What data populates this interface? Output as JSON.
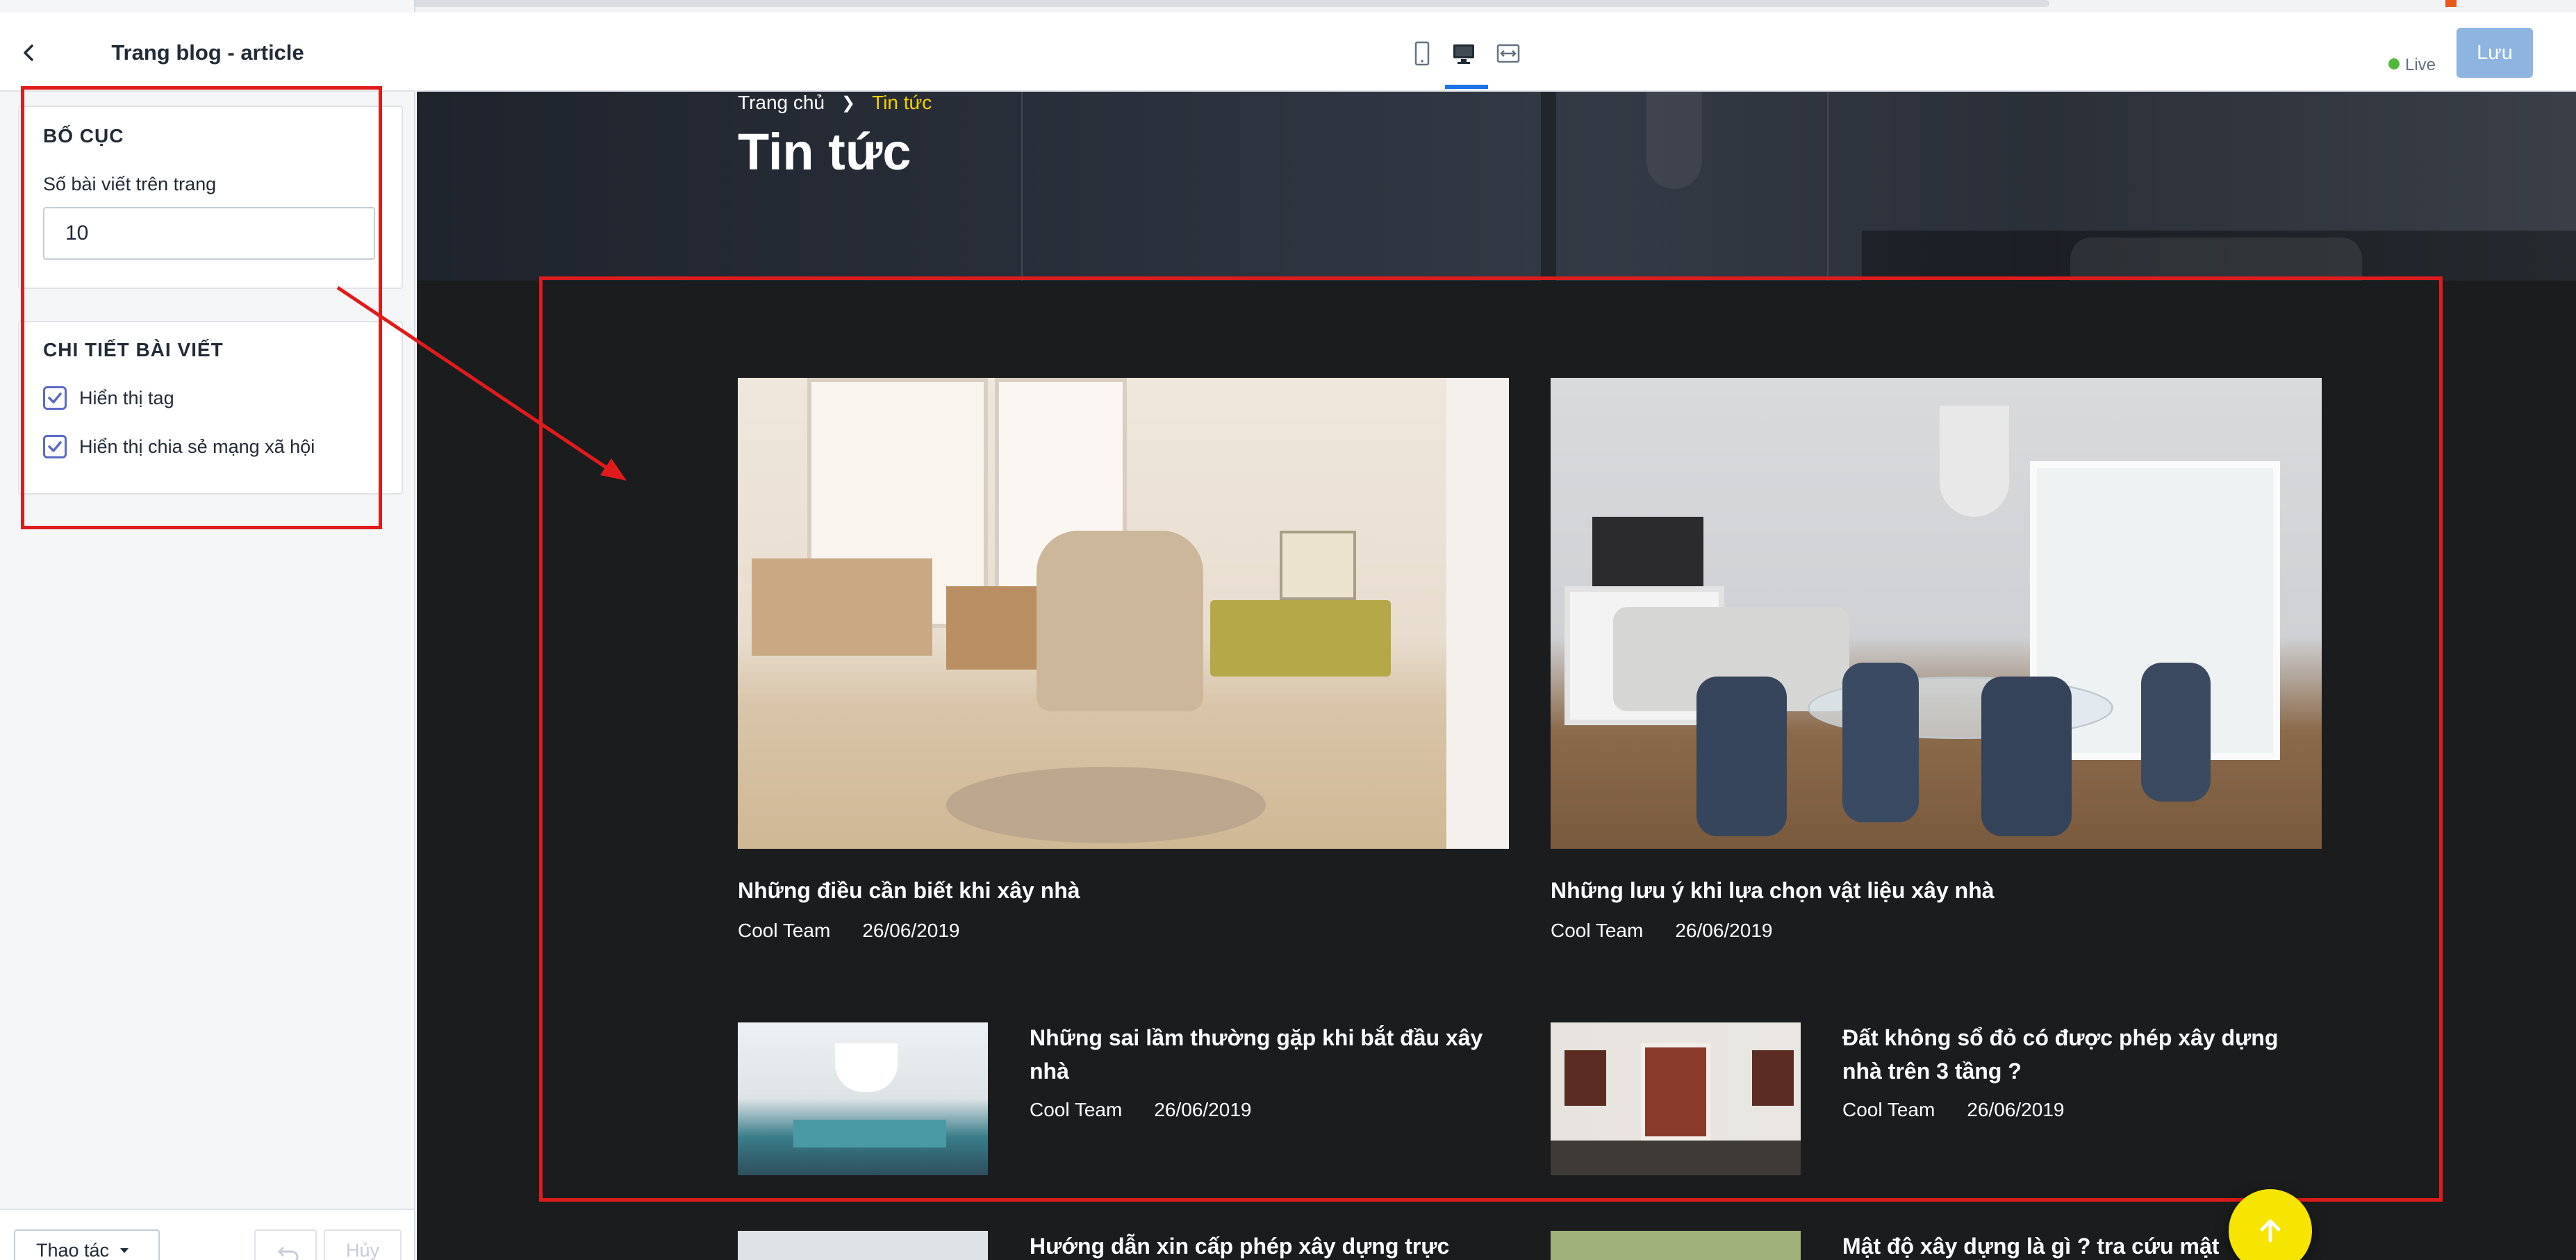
{
  "sidebar": {
    "title": "Trang blog - article",
    "layout_section": {
      "title": "BỐ CỤC",
      "posts_per_page_label": "Số bài viết trên trang",
      "posts_per_page_value": "10"
    },
    "detail_section": {
      "title": "CHI TIẾT BÀI VIẾT",
      "show_tag_label": "Hiển thị tag",
      "show_share_label": "Hiển thị chia sẻ mạng xã hội"
    },
    "footer": {
      "actions_label": "Thao tác",
      "cancel_label": "Hủy"
    }
  },
  "toolbar": {
    "live_label": "Live",
    "save_label": "Lưu",
    "device_icons": [
      "mobile-icon",
      "desktop-icon",
      "fullwidth-icon"
    ],
    "active_device": "desktop"
  },
  "preview": {
    "breadcrumb": {
      "home": "Trang chủ",
      "current": "Tin tức"
    },
    "heading": "Tin tức",
    "featured_posts": [
      {
        "title": "Những điều cần biết khi xây nhà",
        "author": "Cool Team",
        "date": "26/06/2019"
      },
      {
        "title": "Những lưu ý khi lựa chọn vật liệu xây nhà",
        "author": "Cool Team",
        "date": "26/06/2019"
      }
    ],
    "list_posts": [
      {
        "title": "Những sai lầm thường gặp khi bắt đầu xây nhà",
        "author": "Cool Team",
        "date": "26/06/2019"
      },
      {
        "title": "Đất không sổ đỏ có được phép xây dựng nhà trên 3 tầng ?",
        "author": "Cool Team",
        "date": "26/06/2019"
      },
      {
        "title": "Hướng dẫn xin cấp phép xây dựng trực",
        "author": "",
        "date": ""
      },
      {
        "title": "Mật độ xây dựng là gì ? tra cứu mật",
        "author": "",
        "date": ""
      }
    ]
  },
  "colors": {
    "accent": "#f5d000",
    "annotation": "#e01b1b",
    "save_button": "#8eb5e0",
    "live_dot": "#50b83c",
    "checkbox": "#5c6ac4"
  }
}
